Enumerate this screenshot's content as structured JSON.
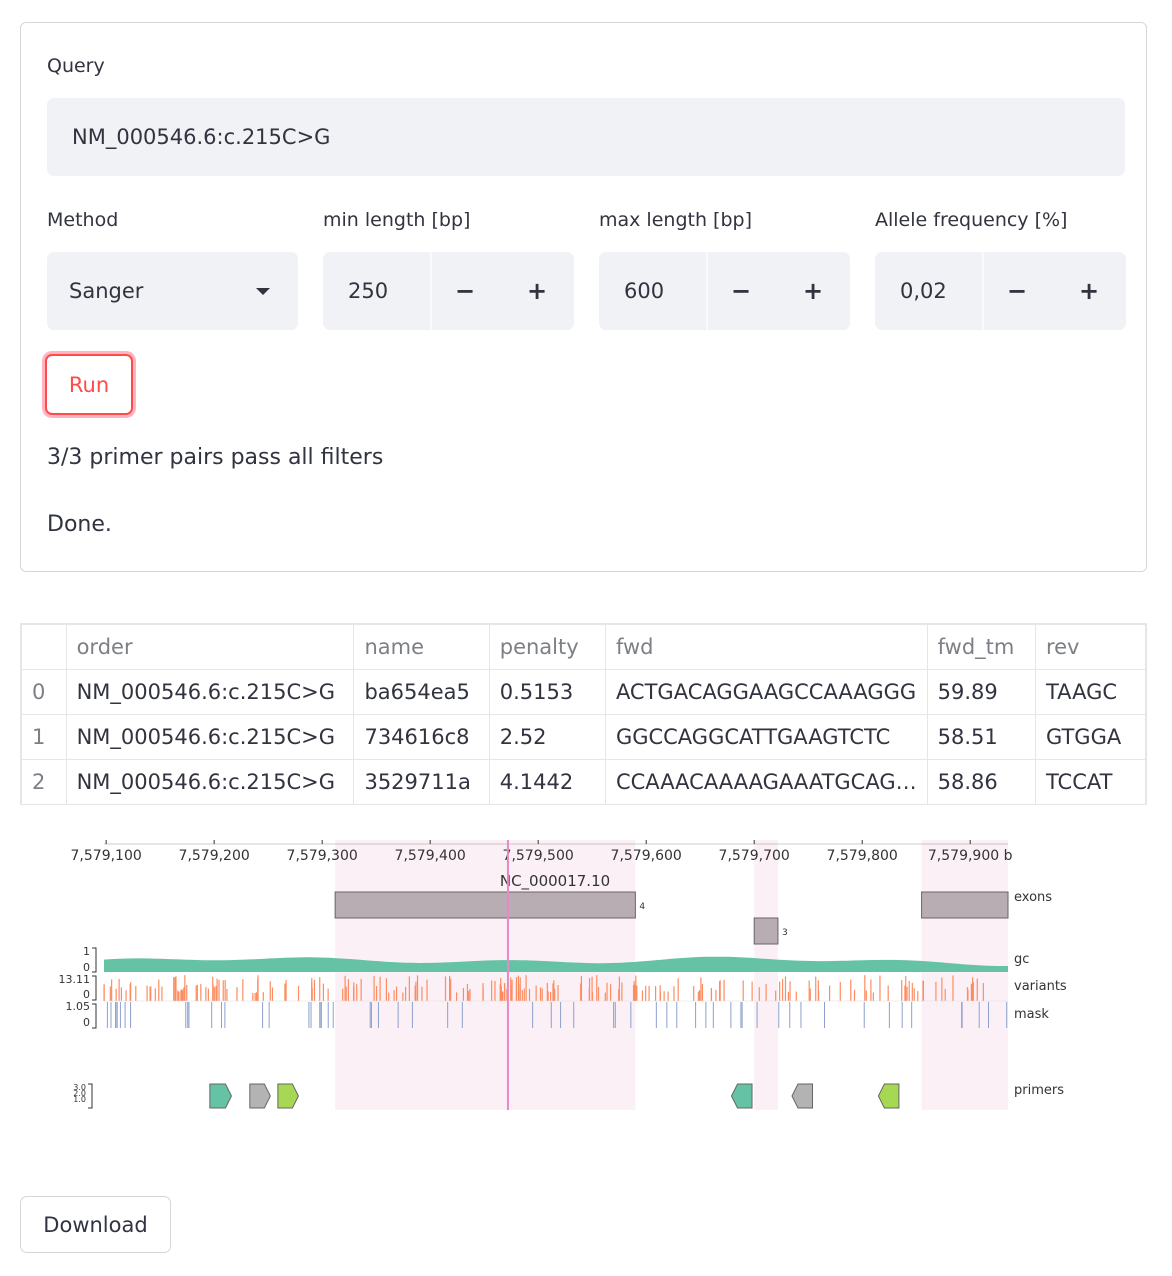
{
  "form": {
    "query_label": "Query",
    "query_value": "NM_000546.6:c.215C>G",
    "method_label": "Method",
    "method_value": "Sanger",
    "min_length_label": "min length [bp]",
    "min_length_value": "250",
    "max_length_label": "max length [bp]",
    "max_length_value": "600",
    "allele_label": "Allele frequency [%]",
    "allele_value": "0,02",
    "minus": "−",
    "plus": "+",
    "run_label": "Run",
    "status_pass": "3/3 primer pairs pass all filters",
    "status_done": "Done."
  },
  "table": {
    "columns": [
      "",
      "order",
      "name",
      "penalty",
      "fwd",
      "fwd_tm",
      "rev"
    ],
    "rows": [
      [
        "0",
        "NM_000546.6:c.215C>G",
        "ba654ea5",
        "0.5153",
        "ACTGACAGGAAGCCAAAGGG",
        "59.89",
        "TAAGC"
      ],
      [
        "1",
        "NM_000546.6:c.215C>G",
        "734616c8",
        "2.52",
        "GGCCAGGCATTGAAGTCTC",
        "58.51",
        "GTGGA"
      ],
      [
        "2",
        "NM_000546.6:c.215C>G",
        "3529711a",
        "4.1442",
        "CCAAACAAAAGAAATGCAG…",
        "58.86",
        "TCCAT"
      ]
    ]
  },
  "chart_data": {
    "type": "genome-track",
    "chrom": "NC_000017.10",
    "x_ticks": [
      "7,579,100",
      "7,579,200",
      "7,579,300",
      "7,579,400",
      "7,579,500",
      "7,579,600",
      "7,579,700",
      "7,579,800",
      "7,579,900"
    ],
    "x_unit": "b",
    "xlim": [
      7579098,
      7579935
    ],
    "variant_position": 7579472,
    "exons": [
      {
        "label": "4",
        "start": 7579312,
        "end": 7579590
      },
      {
        "label": "3",
        "start": 7579700,
        "end": 7579722
      },
      {
        "label": "",
        "start": 7579855,
        "end": 7579935
      }
    ],
    "tracks": [
      "exons",
      "gc",
      "variants",
      "mask",
      "primers"
    ],
    "gc_ticks": [
      "1",
      "0"
    ],
    "variants_ticks": [
      "13.11",
      "0"
    ],
    "mask_ticks": [
      "1.05",
      "0"
    ],
    "primer_ticks": [
      "3.0",
      "2.0",
      "1.0"
    ],
    "primers": [
      {
        "pair": 1,
        "direction": "fwd",
        "start": 7579196,
        "end": 7579216,
        "color": "#66c2a5"
      },
      {
        "pair": 2,
        "direction": "fwd",
        "start": 7579233,
        "end": 7579252,
        "color": "#b3b3b3"
      },
      {
        "pair": 3,
        "direction": "fwd",
        "start": 7579259,
        "end": 7579278,
        "color": "#a6d854"
      },
      {
        "pair": 1,
        "direction": "rev",
        "start": 7579679,
        "end": 7579698,
        "color": "#66c2a5"
      },
      {
        "pair": 2,
        "direction": "rev",
        "start": 7579735,
        "end": 7579754,
        "color": "#b3b3b3"
      },
      {
        "pair": 3,
        "direction": "rev",
        "start": 7579815,
        "end": 7579834,
        "color": "#a6d854"
      }
    ],
    "colors": {
      "exon": "#b9adb4",
      "exon_shade": "#fbf0f6",
      "gc": "#66c2a5",
      "variants": "#fc8d62",
      "mask": "#8da0cb",
      "variant_line": "#e78ac3"
    }
  },
  "download_label": "Download"
}
